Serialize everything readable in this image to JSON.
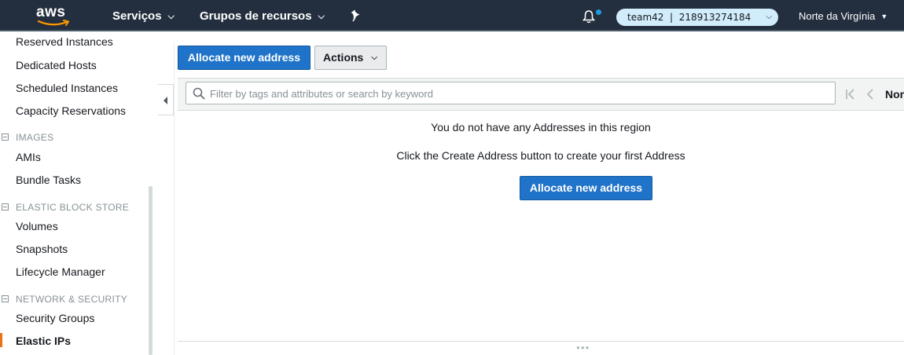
{
  "topnav": {
    "logo": "aws",
    "services_label": "Serviços",
    "resource_groups_label": "Grupos de recursos",
    "pin_icon": "pin-icon",
    "bell_icon": "bell-icon",
    "account": "team42  |  218913274184",
    "region": "Norte da Virgínia",
    "colors": {
      "background": "#232f3e",
      "account_pill": "#d1ecfa",
      "notification_dot": "#1f9bde"
    }
  },
  "sidebar": {
    "items_top": [
      "Reserved Instances",
      "Dedicated Hosts",
      "Scheduled Instances",
      "Capacity Reservations"
    ],
    "sections": [
      {
        "title": "IMAGES",
        "items": [
          "AMIs",
          "Bundle Tasks"
        ]
      },
      {
        "title": "ELASTIC BLOCK STORE",
        "items": [
          "Volumes",
          "Snapshots",
          "Lifecycle Manager"
        ]
      },
      {
        "title": "NETWORK & SECURITY",
        "items": [
          "Security Groups",
          "Elastic IPs"
        ]
      }
    ],
    "active_item": "Elastic IPs",
    "colors": {
      "active_marker": "#ec7211"
    }
  },
  "toolbar": {
    "allocate_label": "Allocate new address",
    "actions_label": "Actions"
  },
  "filter": {
    "placeholder": "Filter by tags and attributes or search by keyword",
    "pager_text": "Nor"
  },
  "empty_state": {
    "line1": "You do not have any Addresses in this region",
    "line2": "Click the Create Address button to create your first Address",
    "button_label": "Allocate new address"
  },
  "colors": {
    "primary_button": "#1f73c8"
  }
}
